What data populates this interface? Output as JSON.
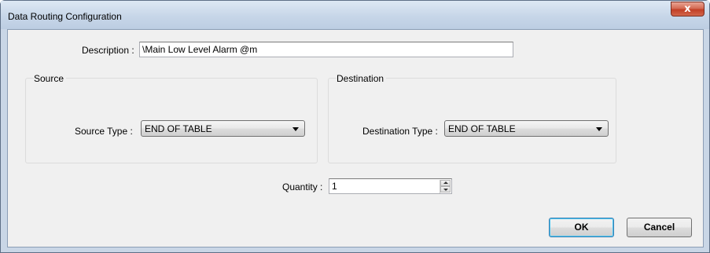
{
  "window": {
    "title": "Data Routing Configuration",
    "close_glyph": "x"
  },
  "form": {
    "description_label": "Description :",
    "description_value": "\\Main Low Level Alarm @m",
    "source": {
      "group_label": "Source",
      "type_label": "Source Type :",
      "type_value": "END OF TABLE"
    },
    "destination": {
      "group_label": "Destination",
      "type_label": "Destination Type :",
      "type_value": "END OF TABLE"
    },
    "quantity_label": "Quantity :",
    "quantity_value": "1"
  },
  "buttons": {
    "ok": "OK",
    "cancel": "Cancel"
  },
  "icons": {
    "close": "close-icon",
    "dropdown": "chevron-down-icon",
    "spin_up": "spin-up-icon",
    "spin_down": "spin-down-icon"
  }
}
